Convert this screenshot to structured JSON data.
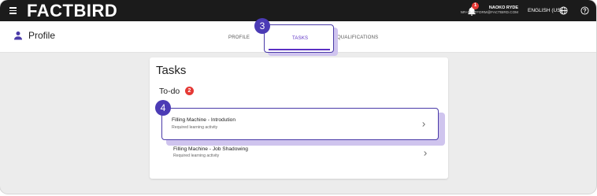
{
  "header": {
    "logo": "FACTBIRD",
    "notification_count": "1",
    "user_name": "NAOKO RYDE",
    "user_email": "NR+PLATFORM@FACTBIRD.COM",
    "language": "ENGLISH (US)"
  },
  "subheader": {
    "title": "Profile",
    "tabs": [
      {
        "label": "PROFILE",
        "active": false
      },
      {
        "label": "TASKS",
        "active": true
      },
      {
        "label": "QUALIFICATIONS",
        "active": false
      }
    ]
  },
  "tasks_panel": {
    "title": "Tasks",
    "todo_label": "To-do",
    "todo_count": "2",
    "items": [
      {
        "name": "Filling Machine - Introdution",
        "subtitle": "Required learning activity"
      },
      {
        "name": "Filling Machine - Job Shadowing",
        "subtitle": "Required learning activity"
      }
    ]
  },
  "annotations": {
    "step_tabs": "3",
    "step_task": "4"
  },
  "colors": {
    "accent": "#5b2fc4",
    "highlight": "#4b3bb5",
    "badge_red": "#e53935",
    "topbar": "#1b1b1b"
  }
}
